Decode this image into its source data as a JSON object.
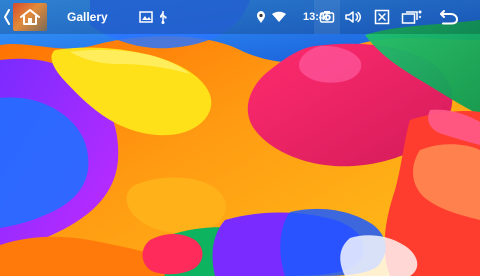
{
  "app": {
    "title": "Gallery"
  },
  "status": {
    "time": "13:46"
  },
  "icons": {
    "back_chevron": "chevron-left-icon",
    "home": "home-icon",
    "image_notification": "image-icon",
    "usb_notification": "usb-icon",
    "location": "location-pin-icon",
    "wifi": "wifi-icon",
    "camera": "camera-icon",
    "volume": "volume-icon",
    "close": "close-box-icon",
    "multi_window": "multi-window-icon",
    "back": "back-arrow-icon"
  },
  "colors": {
    "status_bar_overlay": "#00000030",
    "home_tile": "#d44b2a"
  }
}
